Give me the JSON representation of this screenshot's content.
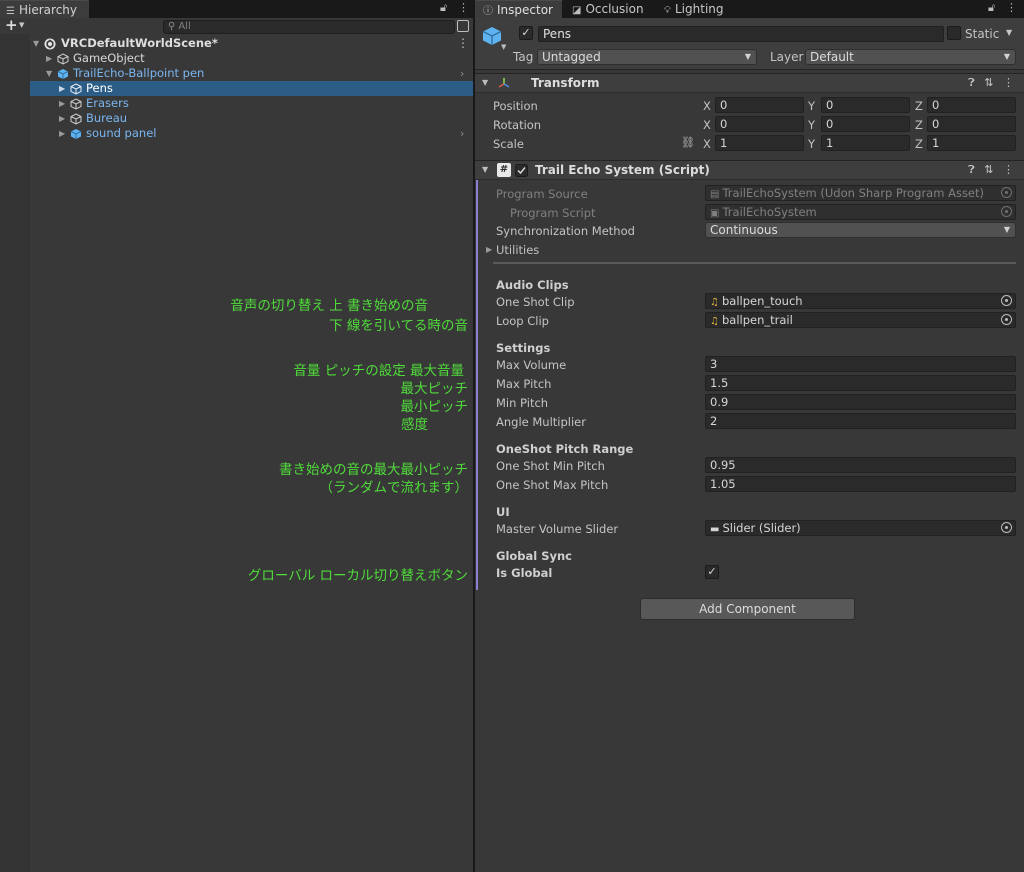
{
  "hierarchy": {
    "tab_label": "Hierarchy",
    "search_placeholder": "All",
    "items": [
      {
        "label": "VRCDefaultWorldScene*",
        "kind": "scene"
      },
      {
        "label": "GameObject",
        "kind": "object"
      },
      {
        "label": "TrailEcho-Ballpoint pen",
        "kind": "prefab"
      },
      {
        "label": "Pens",
        "kind": "prefab",
        "selected": true
      },
      {
        "label": "Erasers",
        "kind": "prefab"
      },
      {
        "label": "Bureau",
        "kind": "prefab"
      },
      {
        "label": "sound panel",
        "kind": "prefab"
      }
    ]
  },
  "annotations": {
    "audio_line1": "音声の切り替え  上  書き始めの音",
    "audio_line2": "下  線を引いてる時の音",
    "volume_line1": "音量  ピッチの設定  最大音量",
    "volume_line2": "最大ピッチ",
    "volume_line3": "最小ピッチ",
    "volume_line4": "感度",
    "oneshot_line1": "書き始めの音の最大最小ピッチ",
    "oneshot_line2": "（ランダムで流れます）",
    "global_line": "グローバル  ローカル切り替えボタン"
  },
  "inspector": {
    "tabs": [
      "Inspector",
      "Occlusion",
      "Lighting"
    ],
    "object_name": "Pens",
    "static_label": "Static",
    "tag_label": "Tag",
    "tag_value": "Untagged",
    "layer_label": "Layer",
    "layer_value": "Default",
    "transform": {
      "title": "Transform",
      "position_label": "Position",
      "rotation_label": "Rotation",
      "scale_label": "Scale",
      "axis_x": "X",
      "axis_y": "Y",
      "axis_z": "Z",
      "position": [
        "0",
        "0",
        "0"
      ],
      "rotation": [
        "0",
        "0",
        "0"
      ],
      "scale": [
        "1",
        "1",
        "1"
      ]
    },
    "script": {
      "title": "Trail Echo System (Script)",
      "program_source_label": "Program Source",
      "program_source_value": "TrailEchoSystem (Udon Sharp Program Asset)",
      "program_script_label": "Program Script",
      "program_script_value": "TrailEchoSystem",
      "sync_label": "Synchronization Method",
      "sync_value": "Continuous",
      "utilities_label": "Utilities",
      "audio_header": "Audio Clips",
      "one_shot_label": "One Shot Clip",
      "one_shot_value": "ballpen_touch",
      "loop_label": "Loop Clip",
      "loop_value": "ballpen_trail",
      "settings_header": "Settings",
      "max_volume_label": "Max Volume",
      "max_volume_value": "3",
      "max_pitch_label": "Max Pitch",
      "max_pitch_value": "1.5",
      "min_pitch_label": "Min Pitch",
      "min_pitch_value": "0.9",
      "angle_label": "Angle Multiplier",
      "angle_value": "2",
      "oneshot_header": "OneShot Pitch Range",
      "oneshot_min_label": "One Shot Min Pitch",
      "oneshot_min_value": "0.95",
      "oneshot_max_label": "One Shot Max Pitch",
      "oneshot_max_value": "1.05",
      "ui_header": "UI",
      "slider_label": "Master Volume Slider",
      "slider_value": "Slider (Slider)",
      "global_header": "Global Sync",
      "is_global_label": "Is Global",
      "is_global": true
    },
    "add_component_label": "Add Component"
  },
  "colors": {
    "selection": "#2c5d87",
    "annotation": "#4fdc3a",
    "prefab_text": "#7bb6f0",
    "script_accent": "#8a7fd1"
  }
}
